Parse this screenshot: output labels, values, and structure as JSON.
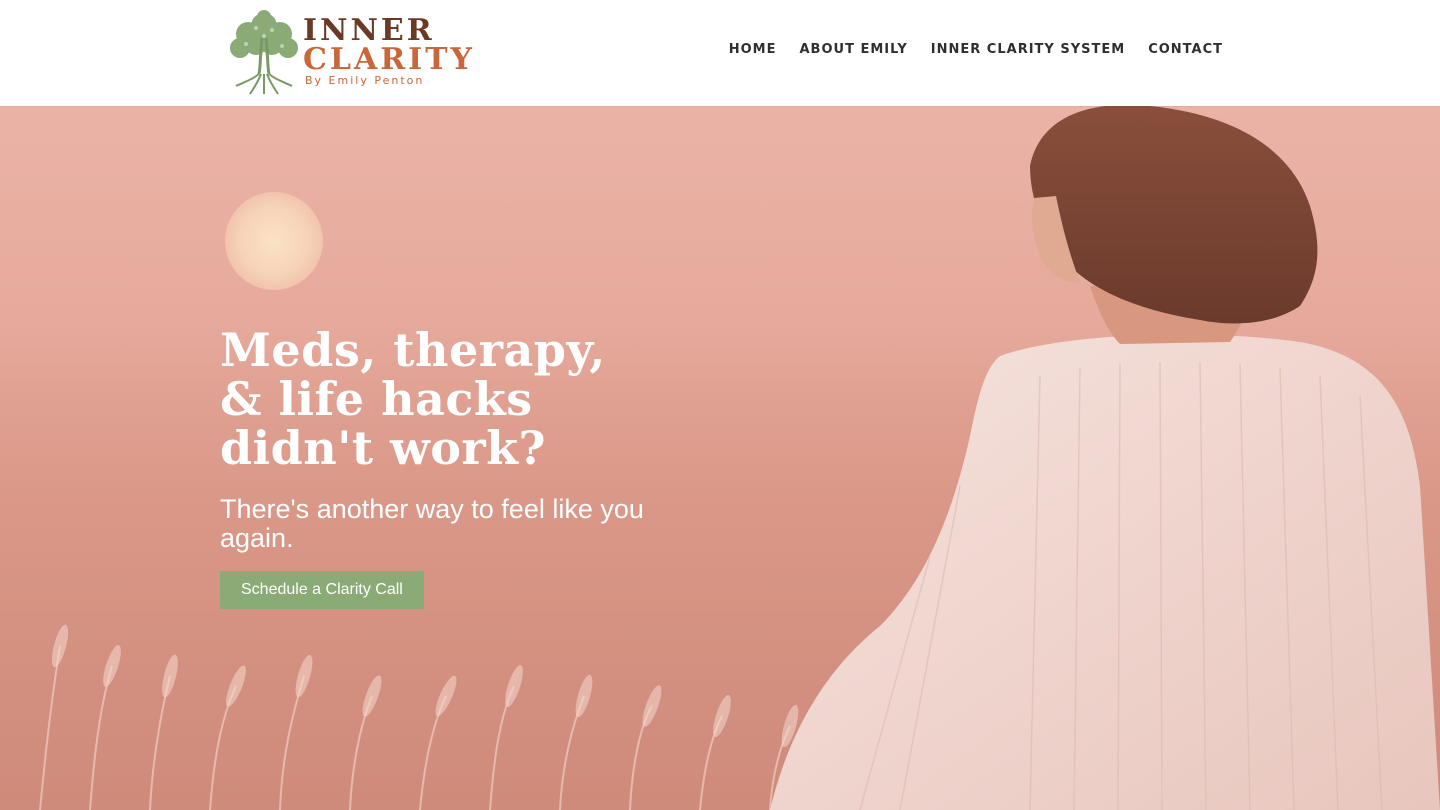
{
  "brand": {
    "line1": "INNER",
    "line2": "CLARITY",
    "byline": "By Emily Penton"
  },
  "nav": {
    "items": [
      {
        "label": "HOME"
      },
      {
        "label": "ABOUT EMILY"
      },
      {
        "label": "INNER CLARITY SYSTEM"
      },
      {
        "label": "CONTACT"
      }
    ]
  },
  "hero": {
    "headline": "Meds, therapy,\n& life hacks\ndidn't work?",
    "subheadline": "There's another way to feel like you again.",
    "cta_label": "Schedule a Clarity Call"
  },
  "colors": {
    "accent_green": "#8aab75",
    "brand_brown": "#6b3a24",
    "brand_orange": "#c9663a",
    "hero_pink": "#e6aa9c"
  }
}
